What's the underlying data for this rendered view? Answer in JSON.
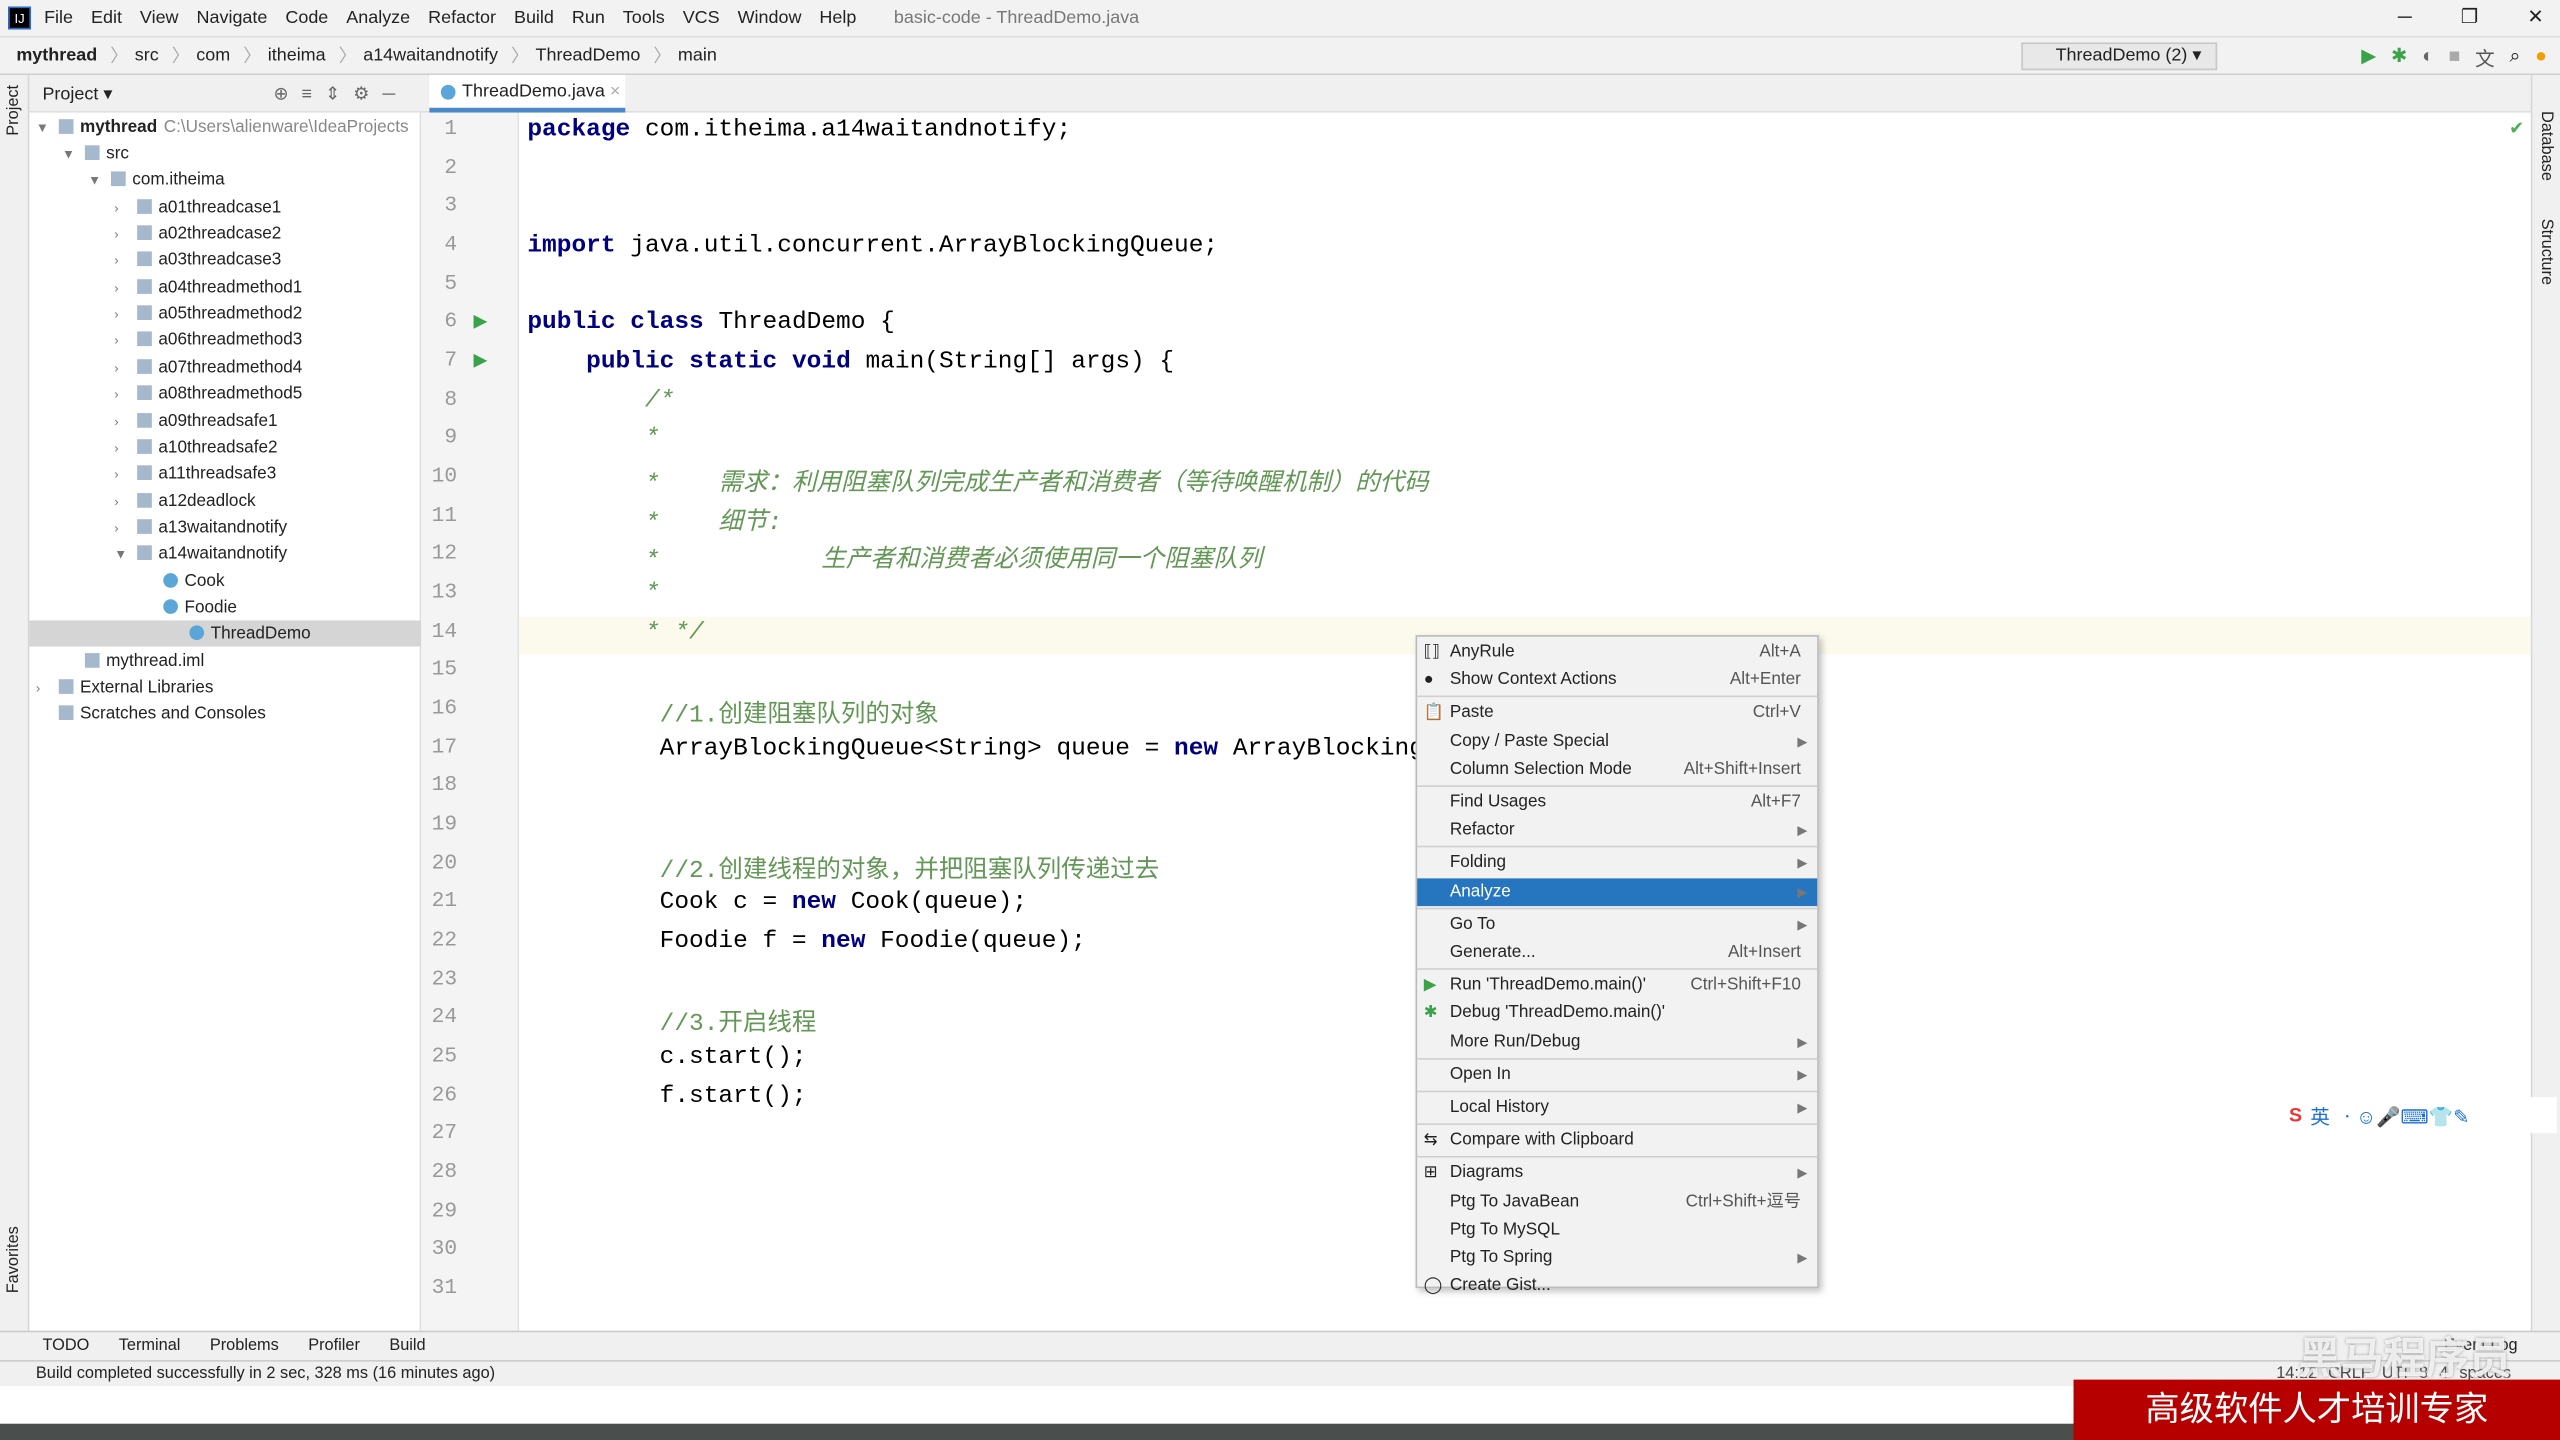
{
  "menubar": {
    "items": [
      "File",
      "Edit",
      "View",
      "Navigate",
      "Code",
      "Analyze",
      "Refactor",
      "Build",
      "Run",
      "Tools",
      "VCS",
      "Window",
      "Help"
    ],
    "window_title": "basic-code - ThreadDemo.java"
  },
  "breadcrumb": [
    "mythread",
    "src",
    "com",
    "itheima",
    "a14waitandnotify",
    "ThreadDemo",
    "main"
  ],
  "toolbar": {
    "run_config": "ThreadDemo (2)"
  },
  "side": {
    "project": "Project",
    "favorites": "Favorites",
    "database": "Database",
    "structure": "Structure"
  },
  "project_panel": {
    "title": "Project",
    "root": "mythread",
    "root_path": "C:\\Users\\alienware\\IdeaProjects",
    "tree": [
      "src",
      "com.itheima",
      "a01threadcase1",
      "a02threadcase2",
      "a03threadcase3",
      "a04threadmethod1",
      "a05threadmethod2",
      "a06threadmethod3",
      "a07threadmethod4",
      "a08threadmethod5",
      "a09threadsafe1",
      "a10threadsafe2",
      "a11threadsafe3",
      "a12deadlock",
      "a13waitandnotify",
      "a14waitandnotify",
      "Cook",
      "Foodie",
      "ThreadDemo",
      "mythread.iml",
      "External Libraries",
      "Scratches and Consoles"
    ]
  },
  "editor": {
    "tab": "ThreadDemo.java",
    "lines": [
      "package com.itheima.a14waitandnotify;",
      "",
      "",
      "import java.util.concurrent.ArrayBlockingQueue;",
      "",
      "public class ThreadDemo {",
      "    public static void main(String[] args) {",
      "        /*",
      "        *",
      "        *    需求：利用阻塞队列完成生产者和消费者（等待唤醒机制）的代码",
      "        *    细节:",
      "        *           生产者和消费者必须使用同一个阻塞队列",
      "        *",
      "        * */",
      "",
      "         //1.创建阻塞队列的对象",
      "         ArrayBlockingQueue<String> queue = new ArrayBlockingQ",
      "",
      "",
      "         //2.创建线程的对象，并把阻塞队列传递过去",
      "         Cook c = new Cook(queue);",
      "         Foodie f = new Foodie(queue);",
      "",
      "         //3.开启线程",
      "         c.start();",
      "         f.start();",
      "",
      "",
      "",
      "",
      ""
    ]
  },
  "context_menu": {
    "items": [
      {
        "label": "AnyRule",
        "shortcut": "Alt+A"
      },
      {
        "label": "Show Context Actions",
        "shortcut": "Alt+Enter"
      },
      {
        "label": "Paste",
        "shortcut": "Ctrl+V"
      },
      {
        "label": "Copy / Paste Special",
        "shortcut": ""
      },
      {
        "label": "Column Selection Mode",
        "shortcut": "Alt+Shift+Insert"
      },
      {
        "label": "Find Usages",
        "shortcut": "Alt+F7"
      },
      {
        "label": "Refactor",
        "shortcut": ""
      },
      {
        "label": "Folding",
        "shortcut": ""
      },
      {
        "label": "Analyze",
        "shortcut": ""
      },
      {
        "label": "Go To",
        "shortcut": ""
      },
      {
        "label": "Generate...",
        "shortcut": "Alt+Insert"
      },
      {
        "label": "Run 'ThreadDemo.main()'",
        "shortcut": "Ctrl+Shift+F10"
      },
      {
        "label": "Debug 'ThreadDemo.main()'",
        "shortcut": ""
      },
      {
        "label": "More Run/Debug",
        "shortcut": ""
      },
      {
        "label": "Open In",
        "shortcut": ""
      },
      {
        "label": "Local History",
        "shortcut": ""
      },
      {
        "label": "Compare with Clipboard",
        "shortcut": ""
      },
      {
        "label": "Diagrams",
        "shortcut": ""
      },
      {
        "label": "Ptg To JavaBean",
        "shortcut": "Ctrl+Shift+逗号"
      },
      {
        "label": "Ptg To MySQL",
        "shortcut": ""
      },
      {
        "label": "Ptg To Spring",
        "shortcut": ""
      },
      {
        "label": "Create Gist...",
        "shortcut": ""
      }
    ]
  },
  "tool_windows": [
    "TODO",
    "Terminal",
    "Problems",
    "Profiler",
    "Build"
  ],
  "event_log": "Event Log",
  "status": {
    "message": "Build completed successfully in 2 sec, 328 ms (16 minutes ago)",
    "position": "14:12",
    "line_sep": "CRLF",
    "encoding": "UTF-8",
    "indent": "4 spaces"
  },
  "ime": {
    "lang": "英"
  },
  "watermark": "黑马程序员",
  "banner": "高级软件人才培训专家",
  "colors": {
    "accent": "#2675bf",
    "banner": "#b60000"
  }
}
